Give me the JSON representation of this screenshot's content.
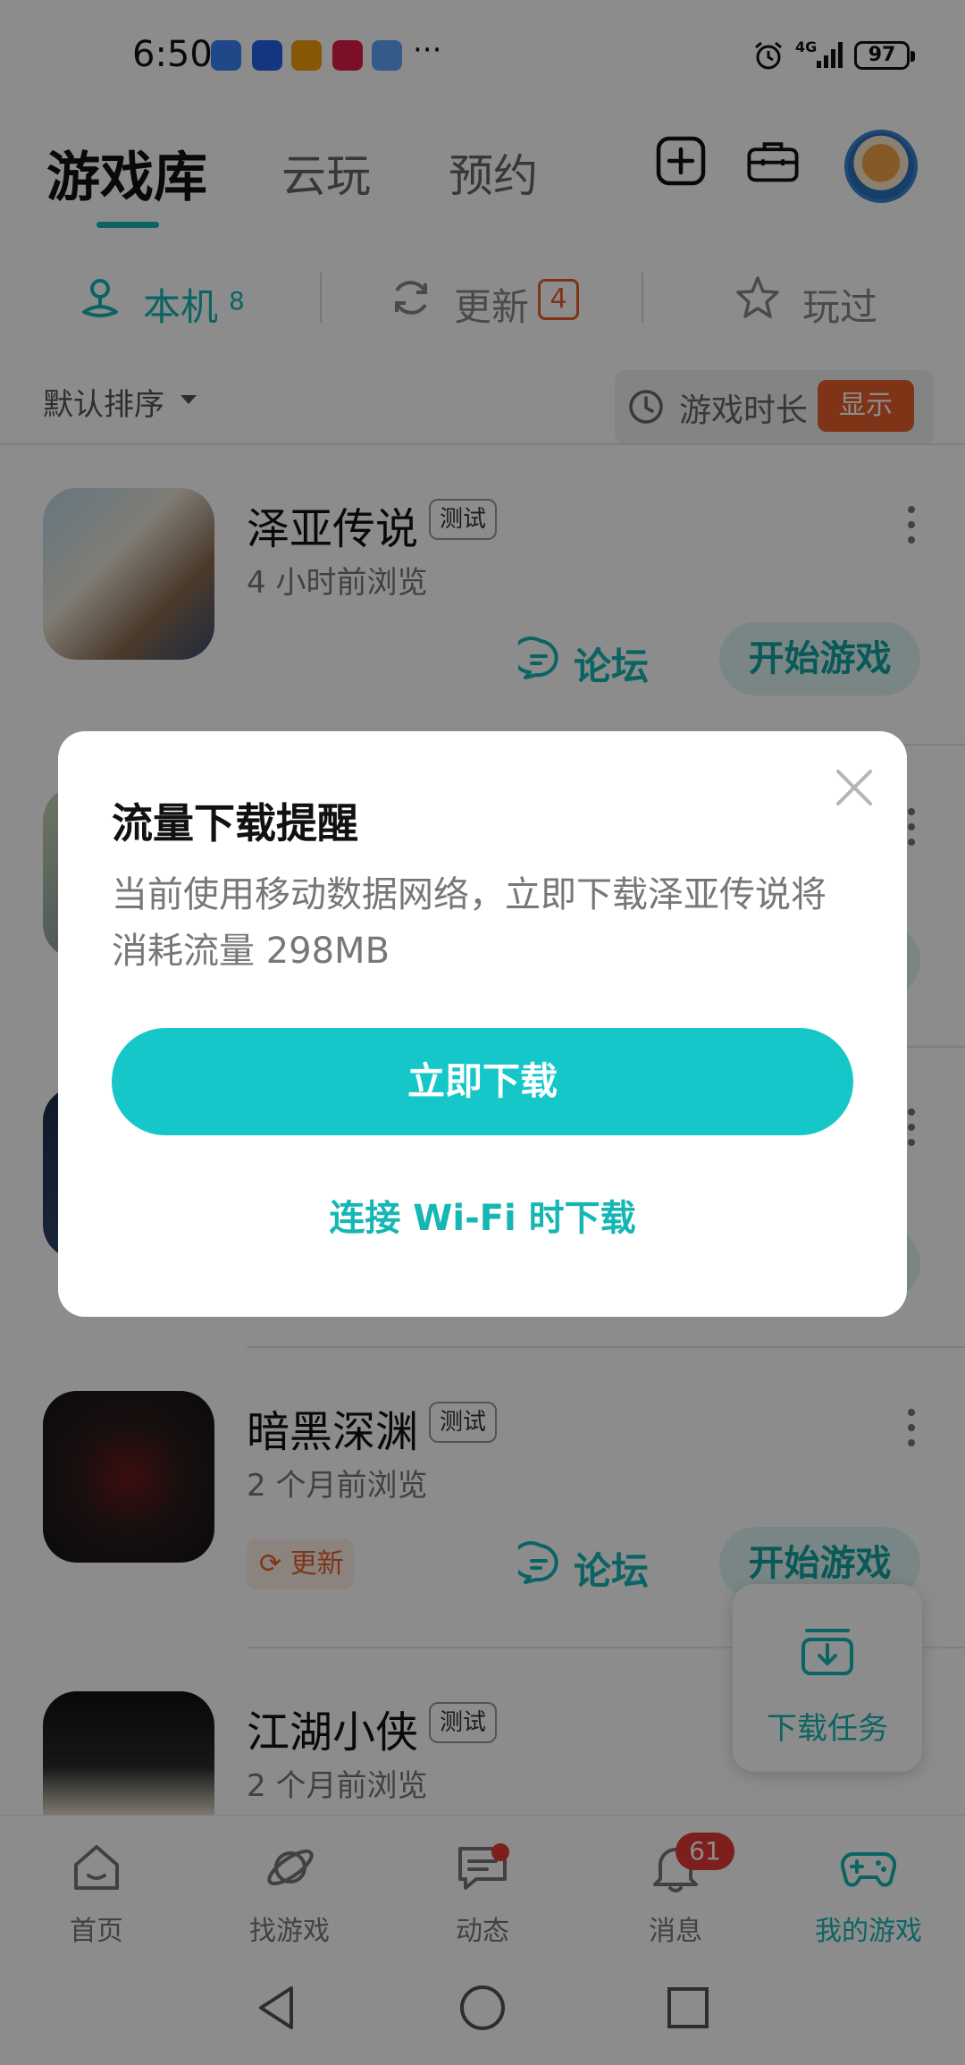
{
  "status_bar": {
    "time": "6:50",
    "more": "···",
    "network": "4G",
    "battery": "97"
  },
  "header": {
    "tabs": [
      {
        "label": "游戏库",
        "active": true
      },
      {
        "label": "云玩"
      },
      {
        "label": "预约"
      }
    ],
    "actions": [
      "add-square-icon",
      "toolbox-icon"
    ]
  },
  "filters": {
    "local": {
      "label": "本机",
      "count": "8"
    },
    "update": {
      "label": "更新",
      "count": "4"
    },
    "played": {
      "label": "玩过"
    }
  },
  "sort": {
    "label": "默认排序",
    "playtime_label": "游戏时长",
    "show_label": "显示"
  },
  "games": [
    {
      "name": "泽亚传说",
      "tag": "测试",
      "sub": "4 小时前浏览",
      "forum": "论坛",
      "start": "开始游戏"
    },
    {
      "name": "暗黑深渊",
      "tag": "测试",
      "sub": "2 个月前浏览",
      "update": "更新",
      "forum": "论坛",
      "start": "开始游戏"
    },
    {
      "name": "江湖小侠",
      "tag": "测试",
      "sub": "2 个月前浏览"
    }
  ],
  "download_task": {
    "label": "下载任务"
  },
  "bottom_nav": [
    {
      "label": "首页"
    },
    {
      "label": "找游戏"
    },
    {
      "label": "动态"
    },
    {
      "label": "消息",
      "badge": "61"
    },
    {
      "label": "我的游戏",
      "active": true
    }
  ],
  "dialog": {
    "title": "流量下载提醒",
    "body": "当前使用移动数据网络，立即下载泽亚传说将消耗流量 298MB",
    "primary": "立即下载",
    "secondary": "连接 Wi-Fi 时下载"
  },
  "colors": {
    "accent": "#15b6b4",
    "primary_button": "#15c7c8",
    "warning": "#e8602c",
    "badge": "#e53935"
  }
}
